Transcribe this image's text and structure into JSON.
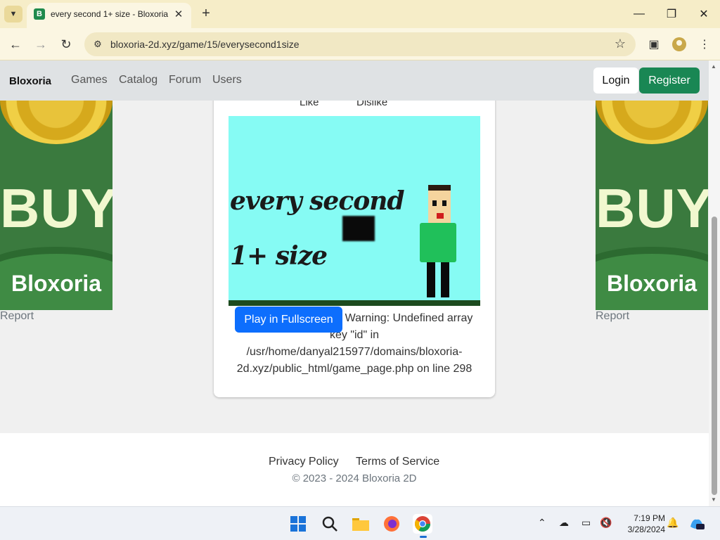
{
  "browser": {
    "tab_title": "every second 1+ size - Bloxoria",
    "tab_favicon_letter": "B",
    "url": "bloxoria-2d.xyz/game/15/everysecond1size"
  },
  "site": {
    "brand": "Bloxoria",
    "nav": [
      "Games",
      "Catalog",
      "Forum",
      "Users"
    ],
    "login_label": "Login",
    "register_label": "Register"
  },
  "ads": {
    "headline": "BUY",
    "brand": "Bloxoria",
    "report_label": "Report"
  },
  "game": {
    "like_label": "Like",
    "dislike_label": "Dislike",
    "thumb_line1": "every second",
    "thumb_line2": "1+ size",
    "play_label": "Play in Fullscreen",
    "warning": "Warning: Undefined array key \"id\" in /usr/home/danyal215977/domains/bloxoria-2d.xyz/public_html/game_page.php on line 298"
  },
  "footer": {
    "privacy": "Privacy Policy",
    "terms": "Terms of Service",
    "copyright": "© 2023 - 2024 Bloxoria 2D"
  },
  "system": {
    "time": "7:19 PM",
    "date": "3/28/2024"
  },
  "colors": {
    "register": "#198754",
    "play": "#0d6efd",
    "game_bg": "#86fbf4",
    "ad_green": "#3a7a3e"
  }
}
